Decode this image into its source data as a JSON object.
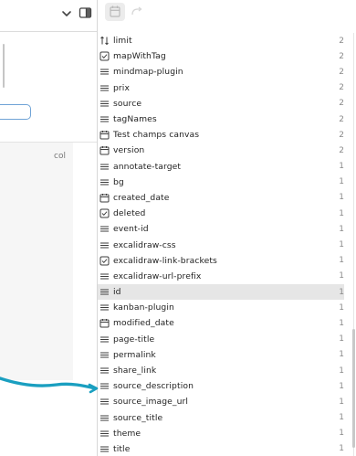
{
  "left": {
    "col_label": "col"
  },
  "icons": {
    "chevron": "chevron-down-icon",
    "sidebar_toggle": "sidebar-toggle-icon",
    "calendar": "calendar-icon",
    "redo": "redo-icon"
  },
  "properties": [
    {
      "name": "limit",
      "type": "number",
      "count": "2"
    },
    {
      "name": "mapWithTag",
      "type": "checkbox",
      "count": "2"
    },
    {
      "name": "mindmap-plugin",
      "type": "text",
      "count": "2"
    },
    {
      "name": "prix",
      "type": "text",
      "count": "2"
    },
    {
      "name": "source",
      "type": "text",
      "count": "2"
    },
    {
      "name": "tagNames",
      "type": "text",
      "count": "2"
    },
    {
      "name": "Test champs canvas",
      "type": "date",
      "count": "2"
    },
    {
      "name": "version",
      "type": "date",
      "count": "2"
    },
    {
      "name": "annotate-target",
      "type": "text",
      "count": "1"
    },
    {
      "name": "bg",
      "type": "text",
      "count": "1"
    },
    {
      "name": "created_date",
      "type": "date",
      "count": "1"
    },
    {
      "name": "deleted",
      "type": "checkbox",
      "count": "1"
    },
    {
      "name": "event-id",
      "type": "text",
      "count": "1"
    },
    {
      "name": "excalidraw-css",
      "type": "text",
      "count": "1"
    },
    {
      "name": "excalidraw-link-brackets",
      "type": "checkbox",
      "count": "1"
    },
    {
      "name": "excalidraw-url-prefix",
      "type": "text",
      "count": "1"
    },
    {
      "name": "id",
      "type": "text",
      "count": "1",
      "active": true
    },
    {
      "name": "kanban-plugin",
      "type": "text",
      "count": "1"
    },
    {
      "name": "modified_date",
      "type": "date",
      "count": "1"
    },
    {
      "name": "page-title",
      "type": "text",
      "count": "1"
    },
    {
      "name": "permalink",
      "type": "text",
      "count": "1"
    },
    {
      "name": "share_link",
      "type": "text",
      "count": "1"
    },
    {
      "name": "source_description",
      "type": "text",
      "count": "1"
    },
    {
      "name": "source_image_url",
      "type": "text",
      "count": "1"
    },
    {
      "name": "source_title",
      "type": "text",
      "count": "1"
    },
    {
      "name": "theme",
      "type": "text",
      "count": "1"
    },
    {
      "name": "title",
      "type": "text",
      "count": "1"
    }
  ],
  "colors": {
    "annotation_stroke": "#1a9fc0",
    "active_row": "#e6e6e6"
  }
}
